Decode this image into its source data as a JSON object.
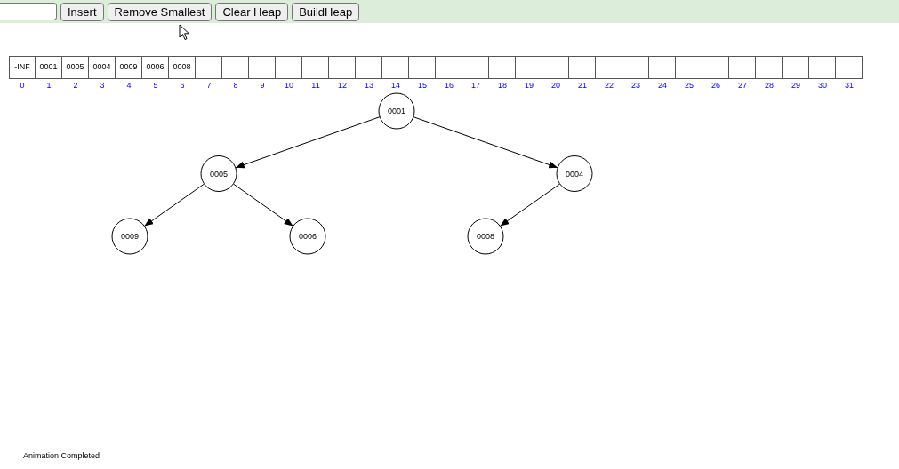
{
  "toolbar": {
    "buttons": [
      "Insert",
      "Remove Smallest",
      "Clear Heap",
      "BuildHeap"
    ]
  },
  "array": {
    "cells": [
      "-INF",
      "0001",
      "0005",
      "0004",
      "0009",
      "0006",
      "0008"
    ],
    "indices": [
      "0",
      "1",
      "2",
      "3",
      "4",
      "5",
      "6",
      "7",
      "8",
      "9",
      "10",
      "11",
      "12",
      "13",
      "14",
      "15",
      "16",
      "17",
      "18",
      "19",
      "20",
      "21",
      "22",
      "23",
      "24",
      "25",
      "26",
      "27",
      "28",
      "29",
      "30",
      "31"
    ]
  },
  "tree": {
    "value": "0001",
    "children": [
      {
        "value": "0005",
        "children": [
          {
            "value": "0009"
          },
          {
            "value": "0006"
          }
        ]
      },
      {
        "value": "0004",
        "children": [
          {
            "value": "0008"
          }
        ]
      }
    ]
  },
  "status": "Animation Completed"
}
